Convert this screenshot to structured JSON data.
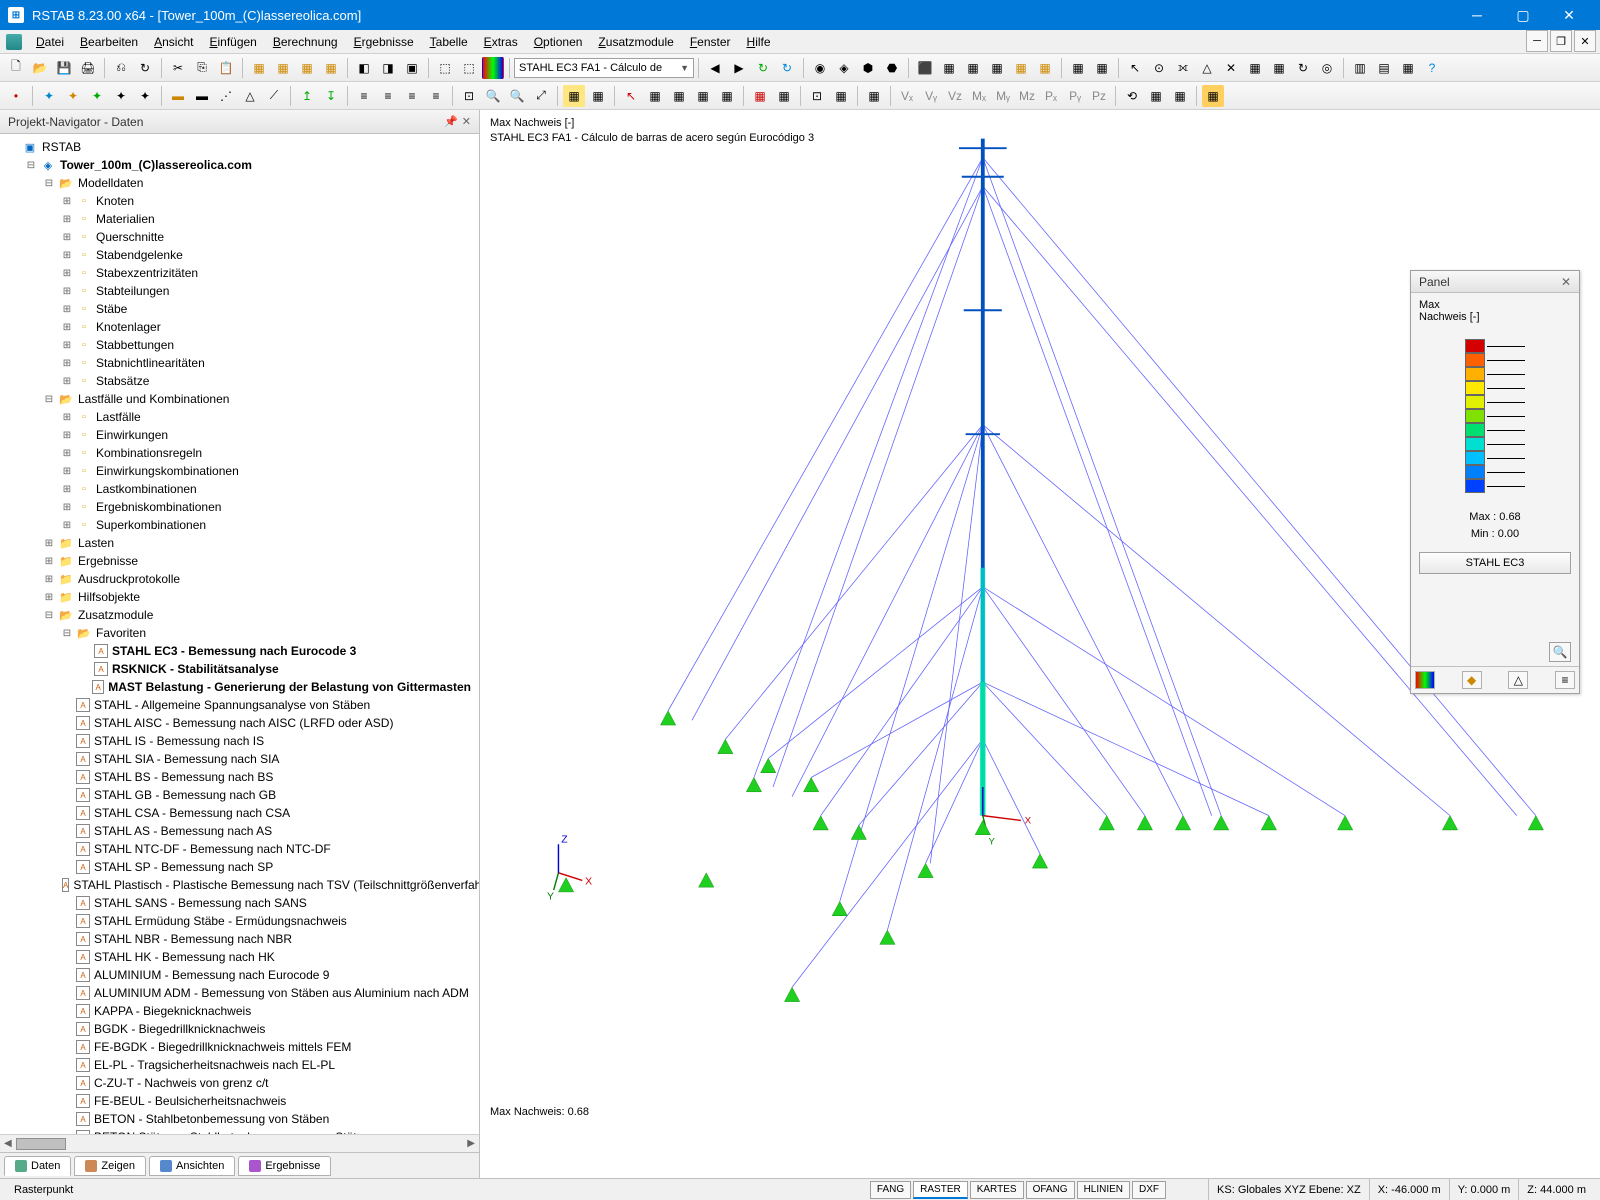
{
  "title": "RSTAB 8.23.00 x64 - [Tower_100m_(C)lassereolica.com]",
  "menu": [
    "Datei",
    "Bearbeiten",
    "Ansicht",
    "Einfügen",
    "Berechnung",
    "Ergebnisse",
    "Tabelle",
    "Extras",
    "Optionen",
    "Zusatzmodule",
    "Fenster",
    "Hilfe"
  ],
  "combo1": "STAHL EC3 FA1 - Cálculo de",
  "navigator": {
    "title": "Projekt-Navigator - Daten",
    "root": "RSTAB",
    "project": "Tower_100m_(C)lassereolica.com",
    "modelldaten": {
      "label": "Modelldaten",
      "children": [
        "Knoten",
        "Materialien",
        "Querschnitte",
        "Stabendgelenke",
        "Stabexzentrizitäten",
        "Stabteilungen",
        "Stäbe",
        "Knotenlager",
        "Stabbettungen",
        "Stabnichtlinearitäten",
        "Stabsätze"
      ]
    },
    "lastfaelle": {
      "label": "Lastfälle und Kombinationen",
      "children": [
        "Lastfälle",
        "Einwirkungen",
        "Kombinationsregeln",
        "Einwirkungskombinationen",
        "Lastkombinationen",
        "Ergebniskombinationen",
        "Superkombinationen"
      ]
    },
    "top_nodes": [
      "Lasten",
      "Ergebnisse",
      "Ausdruckprotokolle",
      "Hilfsobjekte"
    ],
    "zusatz": {
      "label": "Zusatzmodule",
      "fav_label": "Favoriten",
      "favs": [
        "STAHL EC3 - Bemessung nach Eurocode 3",
        "RSKNICK - Stabilitätsanalyse",
        "MAST Belastung - Generierung der Belastung von Gittermasten"
      ],
      "mods": [
        "STAHL - Allgemeine Spannungsanalyse von Stäben",
        "STAHL AISC - Bemessung nach AISC (LRFD oder ASD)",
        "STAHL IS - Bemessung nach IS",
        "STAHL SIA - Bemessung nach SIA",
        "STAHL BS - Bemessung nach BS",
        "STAHL GB - Bemessung nach GB",
        "STAHL CSA - Bemessung nach CSA",
        "STAHL AS - Bemessung nach AS",
        "STAHL NTC-DF - Bemessung nach NTC-DF",
        "STAHL SP - Bemessung nach SP",
        "STAHL Plastisch - Plastische Bemessung nach TSV (Teilschnittgrößenverfahren)",
        "STAHL SANS - Bemessung nach SANS",
        "STAHL Ermüdung Stäbe - Ermüdungsnachweis",
        "STAHL NBR - Bemessung nach NBR",
        "STAHL HK - Bemessung nach HK",
        "ALUMINIUM - Bemessung nach Eurocode 9",
        "ALUMINIUM ADM - Bemessung von Stäben aus Aluminium nach ADM",
        "KAPPA - Biegeknicknachweis",
        "BGDK - Biegedrillknicknachweis",
        "FE-BGDK - Biegedrillknicknachweis mittels FEM",
        "EL-PL - Tragsicherheitsnachweis nach EL-PL",
        "C-ZU-T - Nachweis von grenz c/t",
        "FE-BEUL - Beulsicherheitsnachweis",
        "BETON - Stahlbetonbemessung von Stäben",
        "BETON Stützen - Stahlbetonbemessung von Stützen"
      ]
    },
    "tabs": [
      "Daten",
      "Zeigen",
      "Ansichten",
      "Ergebnisse"
    ]
  },
  "viewport": {
    "line1": "Max Nachweis [-]",
    "line2": "STAHL EC3 FA1 - Cálculo de barras de acero según Eurocódigo 3",
    "bottom": "Max Nachweis: 0.68"
  },
  "panel": {
    "title": "Panel",
    "l1": "Max",
    "l2": "Nachweis [-]",
    "max_label": "Max  :",
    "max_val": "0.68",
    "min_label": "Min   :",
    "min_val": "0.00",
    "btn": "STAHL EC3"
  },
  "scale_colors": [
    "#d40000",
    "#ff6000",
    "#ffb000",
    "#ffe800",
    "#e0f000",
    "#80e000",
    "#00e070",
    "#00e0d0",
    "#00c0ff",
    "#0080ff",
    "#0040ff"
  ],
  "status": {
    "left": "Rasterpunkt",
    "tabs": [
      "FANG",
      "RASTER",
      "KARTES",
      "OFANG",
      "HLINIEN",
      "DXF"
    ],
    "active_tab": 1,
    "ks": "KS: Globales XYZ  Ebene: XZ",
    "x": "X: -46.000 m",
    "y": "Y:   0.000 m",
    "z": "Z:  44.000 m"
  }
}
